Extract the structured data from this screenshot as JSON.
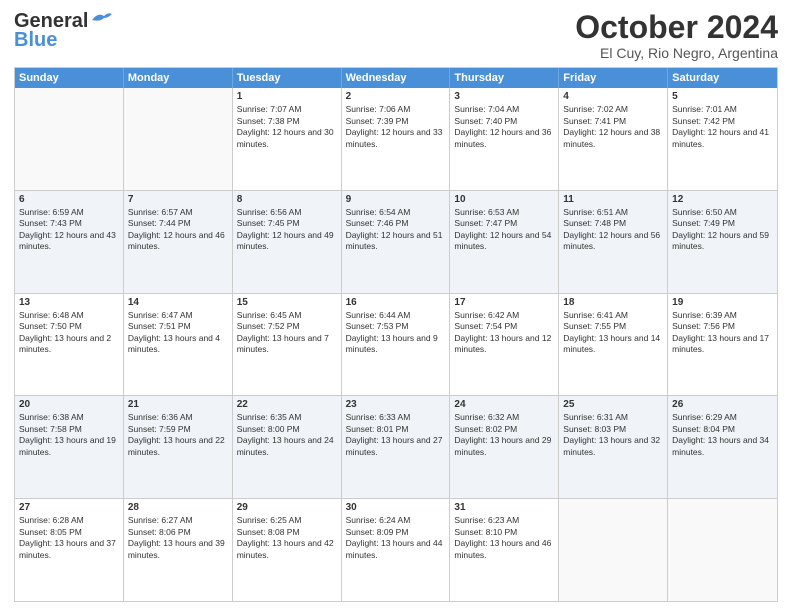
{
  "header": {
    "logo_general": "General",
    "logo_blue": "Blue",
    "month_title": "October 2024",
    "location": "El Cuy, Rio Negro, Argentina"
  },
  "days_of_week": [
    "Sunday",
    "Monday",
    "Tuesday",
    "Wednesday",
    "Thursday",
    "Friday",
    "Saturday"
  ],
  "weeks": [
    [
      {
        "day": "",
        "empty": true
      },
      {
        "day": "",
        "empty": true
      },
      {
        "day": "1",
        "sunrise": "Sunrise: 7:07 AM",
        "sunset": "Sunset: 7:38 PM",
        "daylight": "Daylight: 12 hours and 30 minutes."
      },
      {
        "day": "2",
        "sunrise": "Sunrise: 7:06 AM",
        "sunset": "Sunset: 7:39 PM",
        "daylight": "Daylight: 12 hours and 33 minutes."
      },
      {
        "day": "3",
        "sunrise": "Sunrise: 7:04 AM",
        "sunset": "Sunset: 7:40 PM",
        "daylight": "Daylight: 12 hours and 36 minutes."
      },
      {
        "day": "4",
        "sunrise": "Sunrise: 7:02 AM",
        "sunset": "Sunset: 7:41 PM",
        "daylight": "Daylight: 12 hours and 38 minutes."
      },
      {
        "day": "5",
        "sunrise": "Sunrise: 7:01 AM",
        "sunset": "Sunset: 7:42 PM",
        "daylight": "Daylight: 12 hours and 41 minutes."
      }
    ],
    [
      {
        "day": "6",
        "sunrise": "Sunrise: 6:59 AM",
        "sunset": "Sunset: 7:43 PM",
        "daylight": "Daylight: 12 hours and 43 minutes."
      },
      {
        "day": "7",
        "sunrise": "Sunrise: 6:57 AM",
        "sunset": "Sunset: 7:44 PM",
        "daylight": "Daylight: 12 hours and 46 minutes."
      },
      {
        "day": "8",
        "sunrise": "Sunrise: 6:56 AM",
        "sunset": "Sunset: 7:45 PM",
        "daylight": "Daylight: 12 hours and 49 minutes."
      },
      {
        "day": "9",
        "sunrise": "Sunrise: 6:54 AM",
        "sunset": "Sunset: 7:46 PM",
        "daylight": "Daylight: 12 hours and 51 minutes."
      },
      {
        "day": "10",
        "sunrise": "Sunrise: 6:53 AM",
        "sunset": "Sunset: 7:47 PM",
        "daylight": "Daylight: 12 hours and 54 minutes."
      },
      {
        "day": "11",
        "sunrise": "Sunrise: 6:51 AM",
        "sunset": "Sunset: 7:48 PM",
        "daylight": "Daylight: 12 hours and 56 minutes."
      },
      {
        "day": "12",
        "sunrise": "Sunrise: 6:50 AM",
        "sunset": "Sunset: 7:49 PM",
        "daylight": "Daylight: 12 hours and 59 minutes."
      }
    ],
    [
      {
        "day": "13",
        "sunrise": "Sunrise: 6:48 AM",
        "sunset": "Sunset: 7:50 PM",
        "daylight": "Daylight: 13 hours and 2 minutes."
      },
      {
        "day": "14",
        "sunrise": "Sunrise: 6:47 AM",
        "sunset": "Sunset: 7:51 PM",
        "daylight": "Daylight: 13 hours and 4 minutes."
      },
      {
        "day": "15",
        "sunrise": "Sunrise: 6:45 AM",
        "sunset": "Sunset: 7:52 PM",
        "daylight": "Daylight: 13 hours and 7 minutes."
      },
      {
        "day": "16",
        "sunrise": "Sunrise: 6:44 AM",
        "sunset": "Sunset: 7:53 PM",
        "daylight": "Daylight: 13 hours and 9 minutes."
      },
      {
        "day": "17",
        "sunrise": "Sunrise: 6:42 AM",
        "sunset": "Sunset: 7:54 PM",
        "daylight": "Daylight: 13 hours and 12 minutes."
      },
      {
        "day": "18",
        "sunrise": "Sunrise: 6:41 AM",
        "sunset": "Sunset: 7:55 PM",
        "daylight": "Daylight: 13 hours and 14 minutes."
      },
      {
        "day": "19",
        "sunrise": "Sunrise: 6:39 AM",
        "sunset": "Sunset: 7:56 PM",
        "daylight": "Daylight: 13 hours and 17 minutes."
      }
    ],
    [
      {
        "day": "20",
        "sunrise": "Sunrise: 6:38 AM",
        "sunset": "Sunset: 7:58 PM",
        "daylight": "Daylight: 13 hours and 19 minutes."
      },
      {
        "day": "21",
        "sunrise": "Sunrise: 6:36 AM",
        "sunset": "Sunset: 7:59 PM",
        "daylight": "Daylight: 13 hours and 22 minutes."
      },
      {
        "day": "22",
        "sunrise": "Sunrise: 6:35 AM",
        "sunset": "Sunset: 8:00 PM",
        "daylight": "Daylight: 13 hours and 24 minutes."
      },
      {
        "day": "23",
        "sunrise": "Sunrise: 6:33 AM",
        "sunset": "Sunset: 8:01 PM",
        "daylight": "Daylight: 13 hours and 27 minutes."
      },
      {
        "day": "24",
        "sunrise": "Sunrise: 6:32 AM",
        "sunset": "Sunset: 8:02 PM",
        "daylight": "Daylight: 13 hours and 29 minutes."
      },
      {
        "day": "25",
        "sunrise": "Sunrise: 6:31 AM",
        "sunset": "Sunset: 8:03 PM",
        "daylight": "Daylight: 13 hours and 32 minutes."
      },
      {
        "day": "26",
        "sunrise": "Sunrise: 6:29 AM",
        "sunset": "Sunset: 8:04 PM",
        "daylight": "Daylight: 13 hours and 34 minutes."
      }
    ],
    [
      {
        "day": "27",
        "sunrise": "Sunrise: 6:28 AM",
        "sunset": "Sunset: 8:05 PM",
        "daylight": "Daylight: 13 hours and 37 minutes."
      },
      {
        "day": "28",
        "sunrise": "Sunrise: 6:27 AM",
        "sunset": "Sunset: 8:06 PM",
        "daylight": "Daylight: 13 hours and 39 minutes."
      },
      {
        "day": "29",
        "sunrise": "Sunrise: 6:25 AM",
        "sunset": "Sunset: 8:08 PM",
        "daylight": "Daylight: 13 hours and 42 minutes."
      },
      {
        "day": "30",
        "sunrise": "Sunrise: 6:24 AM",
        "sunset": "Sunset: 8:09 PM",
        "daylight": "Daylight: 13 hours and 44 minutes."
      },
      {
        "day": "31",
        "sunrise": "Sunrise: 6:23 AM",
        "sunset": "Sunset: 8:10 PM",
        "daylight": "Daylight: 13 hours and 46 minutes."
      },
      {
        "day": "",
        "empty": true
      },
      {
        "day": "",
        "empty": true
      }
    ]
  ]
}
